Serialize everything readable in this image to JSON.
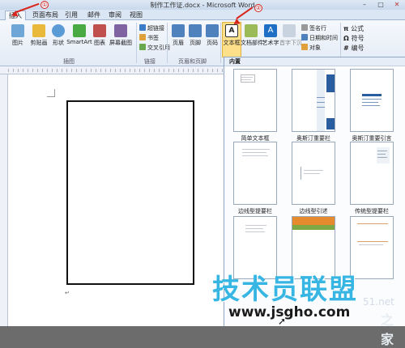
{
  "window": {
    "title": "制作工作证.docx - Microsoft Word"
  },
  "tabs": [
    {
      "label": "插入",
      "active": true
    },
    {
      "label": "页面布局"
    },
    {
      "label": "引用"
    },
    {
      "label": "邮件"
    },
    {
      "label": "审阅"
    },
    {
      "label": "视图"
    }
  ],
  "ribbon": {
    "buttons": [
      {
        "label": "图片"
      },
      {
        "label": "剪贴画"
      },
      {
        "label": "形状"
      },
      {
        "label": "SmartArt"
      },
      {
        "label": "图表"
      },
      {
        "label": "屏幕截图"
      },
      {
        "label": "页眉"
      },
      {
        "label": "页脚"
      },
      {
        "label": "页码"
      },
      {
        "label": "文本框"
      },
      {
        "label": "文档部件"
      },
      {
        "label": "艺术字"
      },
      {
        "label": "首字下沉"
      }
    ],
    "links": [
      "超链接",
      "书签",
      "交叉引用"
    ],
    "text_extras": [
      "签名行",
      "日期和时间",
      "对象"
    ],
    "symbols": [
      "公式",
      "符号",
      "编号"
    ],
    "groups": [
      "插图",
      "链接",
      "页眉和页脚"
    ]
  },
  "gallery": {
    "header": "内置",
    "items": [
      {
        "label": "简单文本框"
      },
      {
        "label": "奥斯汀重要栏"
      },
      {
        "label": "奥斯汀重要引言"
      },
      {
        "label": "边线型提要栏"
      },
      {
        "label": "边线型引述"
      },
      {
        "label": "传统型提要栏"
      },
      {
        "label": ""
      },
      {
        "label": ""
      },
      {
        "label": ""
      }
    ]
  },
  "document": {
    "paragraph_mark": "↵"
  },
  "annotations": {
    "marker1": "①",
    "marker2": "②"
  },
  "watermark": {
    "brand": "技术员联盟",
    "url": "www.jsgho.com",
    "side1": "51.net",
    "side2": "之家"
  },
  "colors": {
    "accent_blue": "#37b6e3",
    "annotation_red": "#d9261c",
    "highlight": "#ffe08a"
  }
}
